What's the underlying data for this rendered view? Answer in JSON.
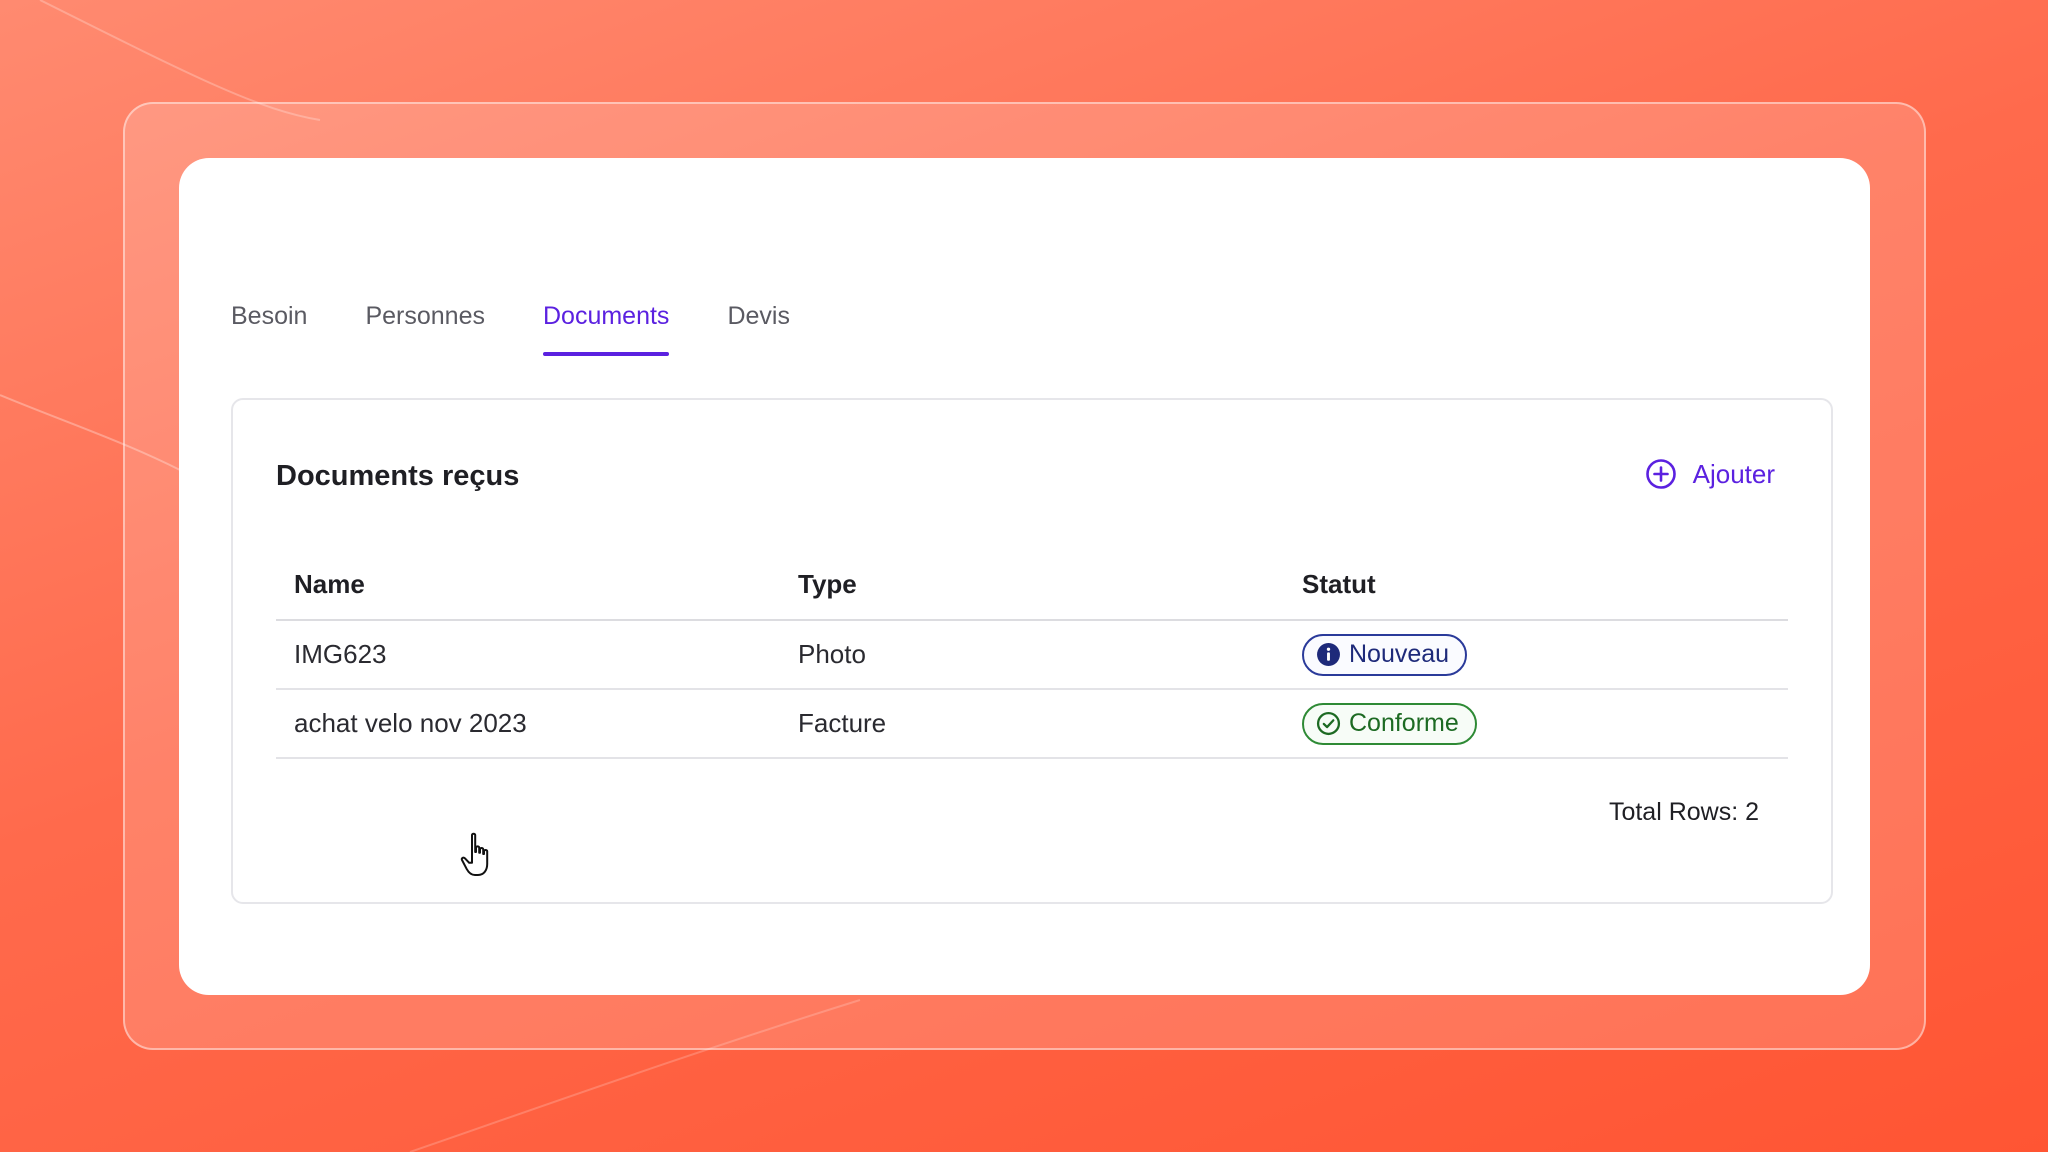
{
  "tabs": [
    {
      "label": "Besoin",
      "active": false
    },
    {
      "label": "Personnes",
      "active": false
    },
    {
      "label": "Documents",
      "active": true
    },
    {
      "label": "Devis",
      "active": false
    }
  ],
  "panel": {
    "title": "Documents reçus",
    "add_label": "Ajouter"
  },
  "table": {
    "headers": [
      "Name",
      "Type",
      "Statut"
    ],
    "rows": [
      {
        "name": "IMG623",
        "type": "Photo",
        "status": "Nouveau",
        "status_icon": "info-icon"
      },
      {
        "name": "achat velo nov 2023",
        "type": "Facture",
        "status": "Conforme",
        "status_icon": "check-circle-icon"
      }
    ],
    "total": "Total Rows: 2"
  },
  "colors": {
    "accent": "#5b21e0",
    "info": "#1e2a7a",
    "success": "#1d6a23",
    "background": "#ff6a4c"
  },
  "icons": {
    "add": "plus-circle-icon",
    "cursor": "hand-pointer-icon"
  }
}
